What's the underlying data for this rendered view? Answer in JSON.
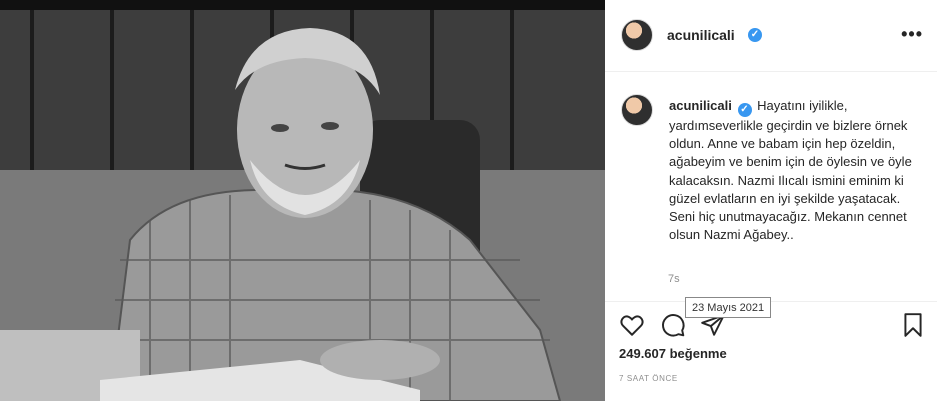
{
  "header": {
    "username": "acunilicali",
    "more_label": "•••"
  },
  "post": {
    "caption_user": "acunilicali",
    "caption_text": "Hayatını iyilikle, yardımseverlikle geçirdin ve bizlere örnek oldun. Anne ve babam için hep özeldin, ağabeyim ve benim için de öylesin ve öyle kalacaksın. Nazmi Ilıcalı ismini eminim ki güzel evlatların en iyi şekilde yaşatacak. Seni hiç unutmayacağız. Mekanın cennet olsun Nazmi Ağabey..",
    "caption_age": "7s",
    "date_tooltip": "23 Mayıs 2021",
    "likes": "249.607 beğenme",
    "posted_ago": "7 SAAT ÖNCE"
  },
  "icons": {
    "verified": "verified-badge-icon",
    "like": "heart-icon",
    "comment": "comment-icon",
    "share": "share-icon",
    "save": "bookmark-icon"
  },
  "colors": {
    "verified": "#3897f0",
    "muted_text": "#8e8e8e",
    "text": "#262626"
  }
}
